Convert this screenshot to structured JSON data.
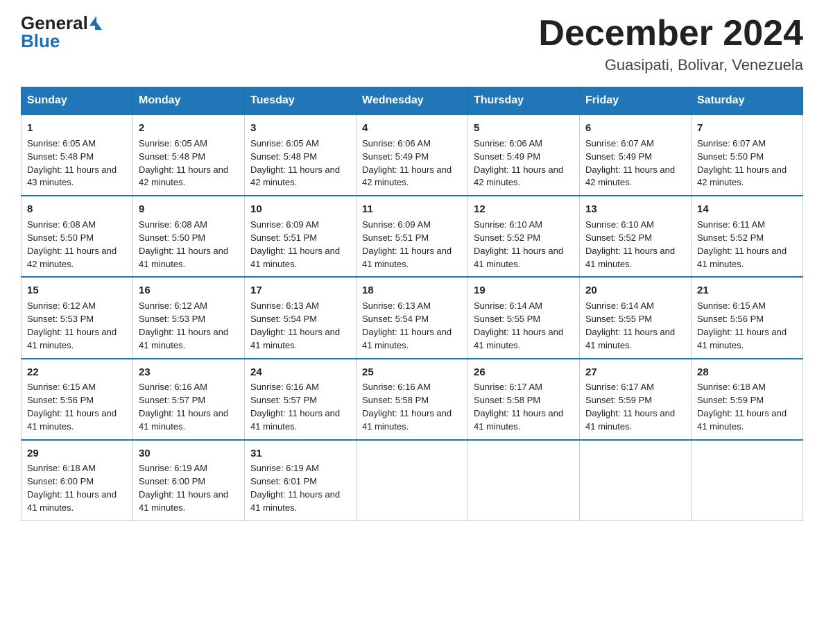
{
  "header": {
    "logo_general": "General",
    "logo_blue": "Blue",
    "month_title": "December 2024",
    "location": "Guasipati, Bolivar, Venezuela"
  },
  "days_of_week": [
    "Sunday",
    "Monday",
    "Tuesday",
    "Wednesday",
    "Thursday",
    "Friday",
    "Saturday"
  ],
  "weeks": [
    [
      {
        "day": "1",
        "sunrise": "6:05 AM",
        "sunset": "5:48 PM",
        "daylight": "11 hours and 43 minutes."
      },
      {
        "day": "2",
        "sunrise": "6:05 AM",
        "sunset": "5:48 PM",
        "daylight": "11 hours and 42 minutes."
      },
      {
        "day": "3",
        "sunrise": "6:05 AM",
        "sunset": "5:48 PM",
        "daylight": "11 hours and 42 minutes."
      },
      {
        "day": "4",
        "sunrise": "6:06 AM",
        "sunset": "5:49 PM",
        "daylight": "11 hours and 42 minutes."
      },
      {
        "day": "5",
        "sunrise": "6:06 AM",
        "sunset": "5:49 PM",
        "daylight": "11 hours and 42 minutes."
      },
      {
        "day": "6",
        "sunrise": "6:07 AM",
        "sunset": "5:49 PM",
        "daylight": "11 hours and 42 minutes."
      },
      {
        "day": "7",
        "sunrise": "6:07 AM",
        "sunset": "5:50 PM",
        "daylight": "11 hours and 42 minutes."
      }
    ],
    [
      {
        "day": "8",
        "sunrise": "6:08 AM",
        "sunset": "5:50 PM",
        "daylight": "11 hours and 42 minutes."
      },
      {
        "day": "9",
        "sunrise": "6:08 AM",
        "sunset": "5:50 PM",
        "daylight": "11 hours and 41 minutes."
      },
      {
        "day": "10",
        "sunrise": "6:09 AM",
        "sunset": "5:51 PM",
        "daylight": "11 hours and 41 minutes."
      },
      {
        "day": "11",
        "sunrise": "6:09 AM",
        "sunset": "5:51 PM",
        "daylight": "11 hours and 41 minutes."
      },
      {
        "day": "12",
        "sunrise": "6:10 AM",
        "sunset": "5:52 PM",
        "daylight": "11 hours and 41 minutes."
      },
      {
        "day": "13",
        "sunrise": "6:10 AM",
        "sunset": "5:52 PM",
        "daylight": "11 hours and 41 minutes."
      },
      {
        "day": "14",
        "sunrise": "6:11 AM",
        "sunset": "5:52 PM",
        "daylight": "11 hours and 41 minutes."
      }
    ],
    [
      {
        "day": "15",
        "sunrise": "6:12 AM",
        "sunset": "5:53 PM",
        "daylight": "11 hours and 41 minutes."
      },
      {
        "day": "16",
        "sunrise": "6:12 AM",
        "sunset": "5:53 PM",
        "daylight": "11 hours and 41 minutes."
      },
      {
        "day": "17",
        "sunrise": "6:13 AM",
        "sunset": "5:54 PM",
        "daylight": "11 hours and 41 minutes."
      },
      {
        "day": "18",
        "sunrise": "6:13 AM",
        "sunset": "5:54 PM",
        "daylight": "11 hours and 41 minutes."
      },
      {
        "day": "19",
        "sunrise": "6:14 AM",
        "sunset": "5:55 PM",
        "daylight": "11 hours and 41 minutes."
      },
      {
        "day": "20",
        "sunrise": "6:14 AM",
        "sunset": "5:55 PM",
        "daylight": "11 hours and 41 minutes."
      },
      {
        "day": "21",
        "sunrise": "6:15 AM",
        "sunset": "5:56 PM",
        "daylight": "11 hours and 41 minutes."
      }
    ],
    [
      {
        "day": "22",
        "sunrise": "6:15 AM",
        "sunset": "5:56 PM",
        "daylight": "11 hours and 41 minutes."
      },
      {
        "day": "23",
        "sunrise": "6:16 AM",
        "sunset": "5:57 PM",
        "daylight": "11 hours and 41 minutes."
      },
      {
        "day": "24",
        "sunrise": "6:16 AM",
        "sunset": "5:57 PM",
        "daylight": "11 hours and 41 minutes."
      },
      {
        "day": "25",
        "sunrise": "6:16 AM",
        "sunset": "5:58 PM",
        "daylight": "11 hours and 41 minutes."
      },
      {
        "day": "26",
        "sunrise": "6:17 AM",
        "sunset": "5:58 PM",
        "daylight": "11 hours and 41 minutes."
      },
      {
        "day": "27",
        "sunrise": "6:17 AM",
        "sunset": "5:59 PM",
        "daylight": "11 hours and 41 minutes."
      },
      {
        "day": "28",
        "sunrise": "6:18 AM",
        "sunset": "5:59 PM",
        "daylight": "11 hours and 41 minutes."
      }
    ],
    [
      {
        "day": "29",
        "sunrise": "6:18 AM",
        "sunset": "6:00 PM",
        "daylight": "11 hours and 41 minutes."
      },
      {
        "day": "30",
        "sunrise": "6:19 AM",
        "sunset": "6:00 PM",
        "daylight": "11 hours and 41 minutes."
      },
      {
        "day": "31",
        "sunrise": "6:19 AM",
        "sunset": "6:01 PM",
        "daylight": "11 hours and 41 minutes."
      },
      {
        "day": "",
        "sunrise": "",
        "sunset": "",
        "daylight": ""
      },
      {
        "day": "",
        "sunrise": "",
        "sunset": "",
        "daylight": ""
      },
      {
        "day": "",
        "sunrise": "",
        "sunset": "",
        "daylight": ""
      },
      {
        "day": "",
        "sunrise": "",
        "sunset": "",
        "daylight": ""
      }
    ]
  ],
  "labels": {
    "sunrise_prefix": "Sunrise: ",
    "sunset_prefix": "Sunset: ",
    "daylight_prefix": "Daylight: "
  }
}
